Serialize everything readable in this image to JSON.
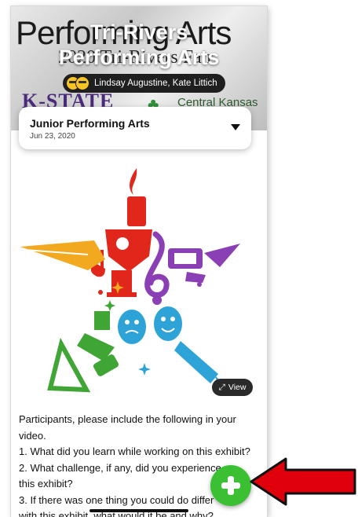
{
  "hero": {
    "background_text": "Performing Arts",
    "background_subtext": "2020 Tri-Rivers Fair",
    "kstate_text": "K-STATE",
    "central_text": "Central Kansas",
    "title_line1": "Tri-Rivers",
    "title_line2": "Performing Arts",
    "authors": "Lindsay Augustine, Kate Littich"
  },
  "exhibit": {
    "name": "Junior Performing Arts",
    "date": "Jun 23, 2020"
  },
  "image": {
    "view_label": "View"
  },
  "description": [
    "Participants, please include the following in your",
    "video.",
    "1. What did you learn while working on this exhibit?",
    "2. What challenge, if any, did you experience",
    "this exhibit?",
    "3. If there was one thing you could do differ",
    "with this exhibit, what would it be and why?"
  ],
  "colors": {
    "fab": "#3bbf33",
    "annotation_arrow": "#e0000b"
  }
}
